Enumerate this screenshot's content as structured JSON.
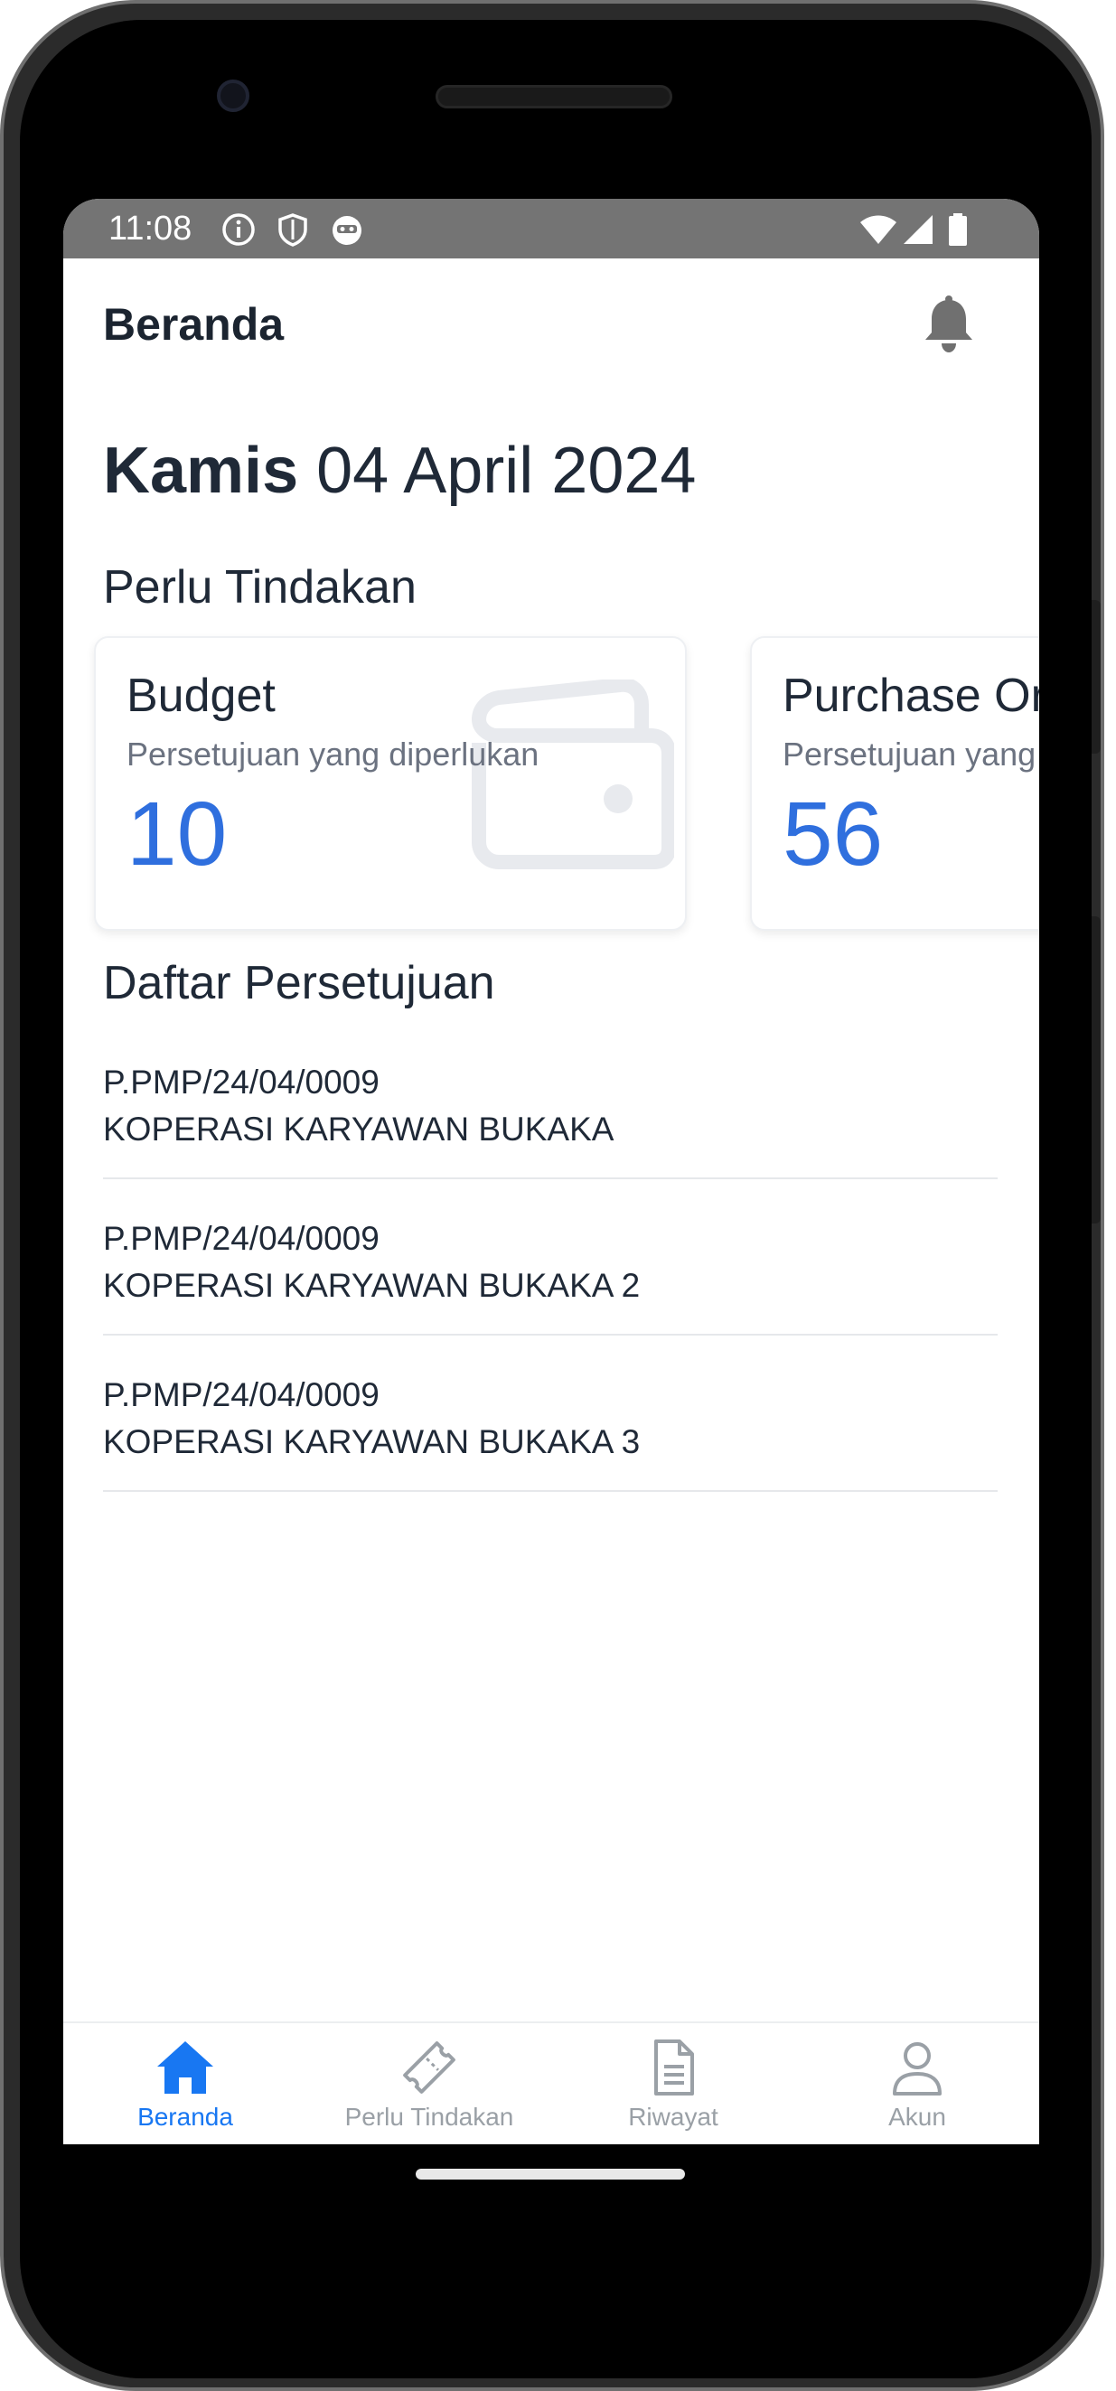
{
  "status_bar": {
    "time": "11:08",
    "icons": [
      "info-icon",
      "shield-icon",
      "face-icon",
      "wifi-icon",
      "signal-icon",
      "battery-icon"
    ]
  },
  "header": {
    "title": "Beranda",
    "notification_icon": "bell-icon"
  },
  "date": {
    "day": "Kamis",
    "date": "04 April 2024"
  },
  "action_section": {
    "title": "Perlu Tindakan",
    "cards": [
      {
        "title": "Budget",
        "subtitle": "Persetujuan yang diperlukan",
        "count": "10",
        "icon": "wallet-icon"
      },
      {
        "title": "Purchase Order",
        "subtitle": "Persetujuan yang diperlukan",
        "count": "56"
      }
    ]
  },
  "approval_section": {
    "title": "Daftar Persetujuan",
    "items": [
      {
        "code": "P.PMP/24/04/0009",
        "name": "KOPERASI KARYAWAN BUKAKA"
      },
      {
        "code": "P.PMP/24/04/0009",
        "name": "KOPERASI KARYAWAN BUKAKA 2"
      },
      {
        "code": "P.PMP/24/04/0009",
        "name": "KOPERASI KARYAWAN BUKAKA 3"
      }
    ]
  },
  "bottom_nav": {
    "items": [
      {
        "label": "Beranda",
        "icon": "home-icon",
        "active": true
      },
      {
        "label": "Perlu Tindakan",
        "icon": "ticket-icon",
        "active": false
      },
      {
        "label": "Riwayat",
        "icon": "document-icon",
        "active": false
      },
      {
        "label": "Akun",
        "icon": "user-icon",
        "active": false
      }
    ]
  },
  "colors": {
    "accent": "#1877f2",
    "count": "#2f6fde",
    "status_bar": "#747474",
    "text": "#1f2937",
    "muted": "#9aa0a6"
  }
}
